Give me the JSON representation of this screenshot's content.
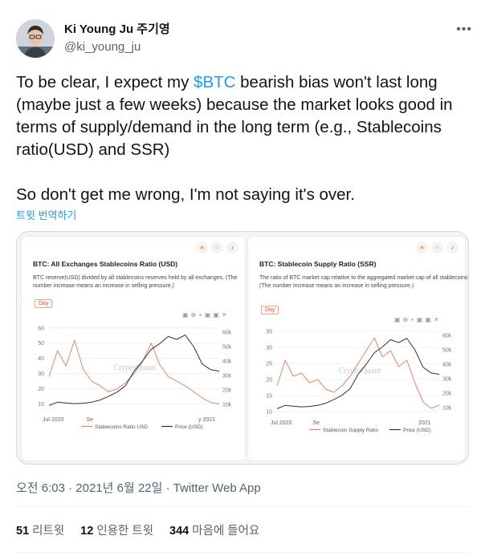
{
  "tweet": {
    "display_name": "Ki Young Ju 주기영",
    "handle": "@ki_young_ju",
    "more_label": "•••",
    "text_p1_before": "To be clear, I expect my ",
    "cashtag": "$BTC",
    "text_p1_after": " bearish bias won't last long (maybe just a few weeks) because the market looks good in terms of supply/demand in the long term (e.g., Stablecoins ratio(USD) and SSR)",
    "text_p2": "So don't get me wrong, I'm not saying it's over.",
    "translate_label": "트윗 번역하기",
    "meta": "오전 6:03 · 2021년 6월 22일 · Twitter Web App",
    "stats": {
      "retweets_count": "51",
      "retweets_label": "리트윗",
      "quotes_count": "12",
      "quotes_label": "인용한 트윗",
      "likes_count": "344",
      "likes_label": "마음에 들어요"
    }
  },
  "colors": {
    "accent": "#1d9bf0",
    "ratio_line": "#e8866a",
    "price_line": "#333333"
  },
  "panels": [
    {
      "title": "BTC: All Exchanges Stablecoins Ratio (USD)",
      "description": "BTC reserve(USD) divided by all stablecoins reserves held by all exchanges. (The number increase means an increase in selling pressure.)",
      "day_button": "Day",
      "watermark": "CryptoQuant",
      "x_start": "Jul 2020",
      "x_mid": "Se",
      "x_end": "y 2021",
      "legend_ratio": "Stablecoins Ratio USD",
      "legend_price": "Price (USD)"
    },
    {
      "title": "BTC: Stablecoin Supply Ratio (SSR)",
      "description": "The ratio of BTC market cap relative to the aggregated market cap of all stablecoins. (The number increase means an increase in selling pressure.)",
      "day_button": "Day",
      "watermark": "CryptoQuant",
      "x_start": "Jul 2020",
      "x_mid": "Se",
      "x_end": "2021",
      "legend_ratio": "Stablecoin Supply Ratio",
      "legend_price": "Price (USD)"
    }
  ],
  "chart_data": [
    {
      "type": "line",
      "title": "BTC: All Exchanges Stablecoins Ratio (USD)",
      "y_left_ticks": [
        "60",
        "50",
        "40",
        "30",
        "20",
        "10"
      ],
      "y_right_ticks": [
        "60k",
        "50k",
        "40k",
        "30k",
        "20k",
        "10k"
      ],
      "ylim_left": [
        5,
        62
      ],
      "ylim_right": [
        5000,
        65000
      ],
      "x": [
        0,
        0.05,
        0.1,
        0.15,
        0.2,
        0.25,
        0.3,
        0.35,
        0.4,
        0.45,
        0.5,
        0.55,
        0.6,
        0.65,
        0.7,
        0.75,
        0.8,
        0.85,
        0.9,
        0.95,
        1.0
      ],
      "series": [
        {
          "name": "Stablecoins Ratio USD",
          "axis": "left",
          "values": [
            28,
            45,
            35,
            52,
            33,
            25,
            22,
            18,
            20,
            24,
            30,
            38,
            50,
            36,
            28,
            25,
            22,
            18,
            14,
            11,
            10
          ]
        },
        {
          "name": "Price (USD)",
          "axis": "right",
          "values": [
            9200,
            11500,
            11000,
            10500,
            10800,
            11500,
            13000,
            15500,
            18500,
            23000,
            33000,
            40000,
            48000,
            52000,
            57000,
            55000,
            58000,
            50000,
            38000,
            34000,
            33000
          ]
        }
      ]
    },
    {
      "type": "line",
      "title": "BTC: Stablecoin Supply Ratio (SSR)",
      "y_left_ticks": [
        "35",
        "30",
        "25",
        "20",
        "15",
        "10"
      ],
      "y_right_ticks": [
        "60k",
        "50k",
        "40k",
        "30k",
        "20k",
        "10k"
      ],
      "ylim_left": [
        9,
        36
      ],
      "ylim_right": [
        5000,
        65000
      ],
      "x": [
        0,
        0.05,
        0.1,
        0.15,
        0.2,
        0.25,
        0.3,
        0.35,
        0.4,
        0.45,
        0.5,
        0.55,
        0.6,
        0.65,
        0.7,
        0.75,
        0.8,
        0.85,
        0.9,
        0.95,
        1.0
      ],
      "series": [
        {
          "name": "Stablecoin Supply Ratio",
          "axis": "left",
          "values": [
            18,
            26,
            21,
            22,
            19,
            20,
            17,
            16,
            18,
            21,
            25,
            29,
            33,
            27,
            29,
            24,
            26,
            19,
            13,
            11,
            12
          ]
        },
        {
          "name": "Price (USD)",
          "axis": "right",
          "values": [
            9200,
            11500,
            11000,
            10500,
            10800,
            11500,
            13000,
            15500,
            18500,
            23000,
            33000,
            40000,
            48000,
            52000,
            57000,
            55000,
            58000,
            50000,
            38000,
            34000,
            33000
          ]
        }
      ]
    }
  ]
}
